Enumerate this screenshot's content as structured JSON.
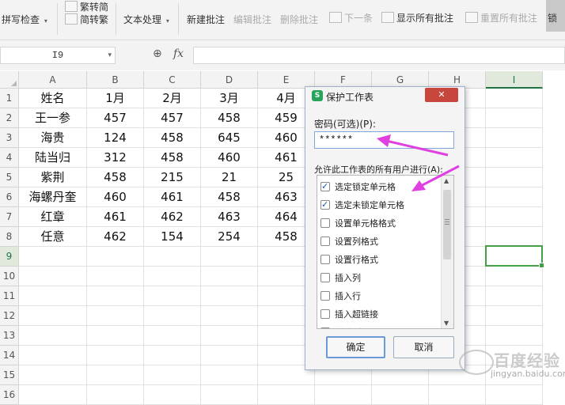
{
  "ribbon": {
    "spell_check": "拼写检查",
    "trad_simp": "繁转简",
    "simp_trad": "简转繁",
    "text_process": "文本处理",
    "new_comment": "新建批注",
    "edit_comment": "编辑批注",
    "delete_comment": "删除批注",
    "next": "下一条",
    "show_all": "显示所有批注",
    "reset_all": "重置所有批注",
    "lock": "锁"
  },
  "formula_bar": {
    "name_box": "I9",
    "fx": "fx",
    "formula": ""
  },
  "sheet": {
    "columns": [
      "A",
      "B",
      "C",
      "D",
      "E",
      "F",
      "G",
      "H",
      "I"
    ],
    "selected_column": "I",
    "rows": [
      "1",
      "2",
      "3",
      "4",
      "5",
      "6",
      "7",
      "8",
      "9",
      "10",
      "11",
      "12",
      "13",
      "14",
      "15",
      "16"
    ],
    "selected_row": "9",
    "data": [
      [
        "姓名",
        "1月",
        "2月",
        "3月",
        "4月"
      ],
      [
        "王一参",
        "457",
        "457",
        "458",
        "459"
      ],
      [
        "海贵",
        "124",
        "458",
        "645",
        "460"
      ],
      [
        "陆当归",
        "312",
        "458",
        "460",
        "461"
      ],
      [
        "紫荆",
        "458",
        "215",
        "21",
        "25"
      ],
      [
        "海螺丹奎",
        "460",
        "461",
        "458",
        "463"
      ],
      [
        "红章",
        "461",
        "462",
        "463",
        "464"
      ],
      [
        "任意",
        "462",
        "154",
        "254",
        "458"
      ]
    ],
    "active_cell": "I9"
  },
  "dialog": {
    "title": "保护工作表",
    "close_label": "✕",
    "password_label": "密码(可选)(P):",
    "password_value": "******",
    "permissions_label": "允许此工作表的所有用户进行(A):",
    "permissions": [
      {
        "label": "选定锁定单元格",
        "checked": true
      },
      {
        "label": "选定未锁定单元格",
        "checked": true
      },
      {
        "label": "设置单元格格式",
        "checked": false
      },
      {
        "label": "设置列格式",
        "checked": false
      },
      {
        "label": "设置行格式",
        "checked": false
      },
      {
        "label": "插入列",
        "checked": false
      },
      {
        "label": "插入行",
        "checked": false
      },
      {
        "label": "插入超链接",
        "checked": false
      },
      {
        "label": "删除列",
        "checked": false
      }
    ],
    "ok": "确定",
    "cancel": "取消"
  },
  "annotations": {
    "arrow_color": "#e040e0"
  },
  "watermark": {
    "text": "百度经验",
    "url": "jingyan.baidu.com"
  }
}
